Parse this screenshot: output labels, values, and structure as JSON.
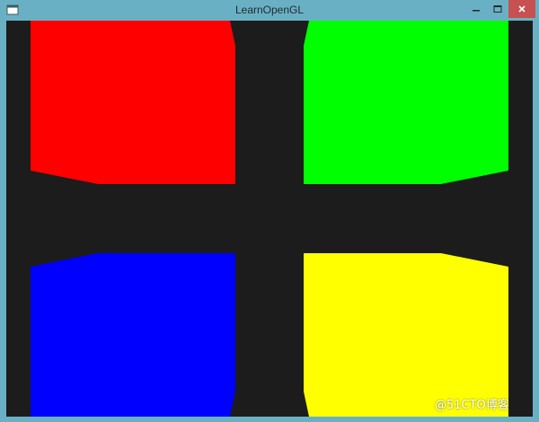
{
  "window": {
    "title": "LearnOpenGL",
    "icon": "app-window-icon",
    "controls": {
      "minimize_icon": "minimize-icon",
      "maximize_icon": "maximize-icon",
      "close_icon": "close-icon"
    },
    "colors": {
      "frame": "#6ab0c4",
      "close_button": "#c75050",
      "clear_color": "#1c1c1c"
    }
  },
  "scene": {
    "cubes": [
      {
        "name": "red",
        "color": "#ff0000"
      },
      {
        "name": "green",
        "color": "#00ff00"
      },
      {
        "name": "blue",
        "color": "#0000ff"
      },
      {
        "name": "yellow",
        "color": "#ffff00"
      }
    ]
  },
  "watermark": {
    "text": "@51CTO博客"
  }
}
